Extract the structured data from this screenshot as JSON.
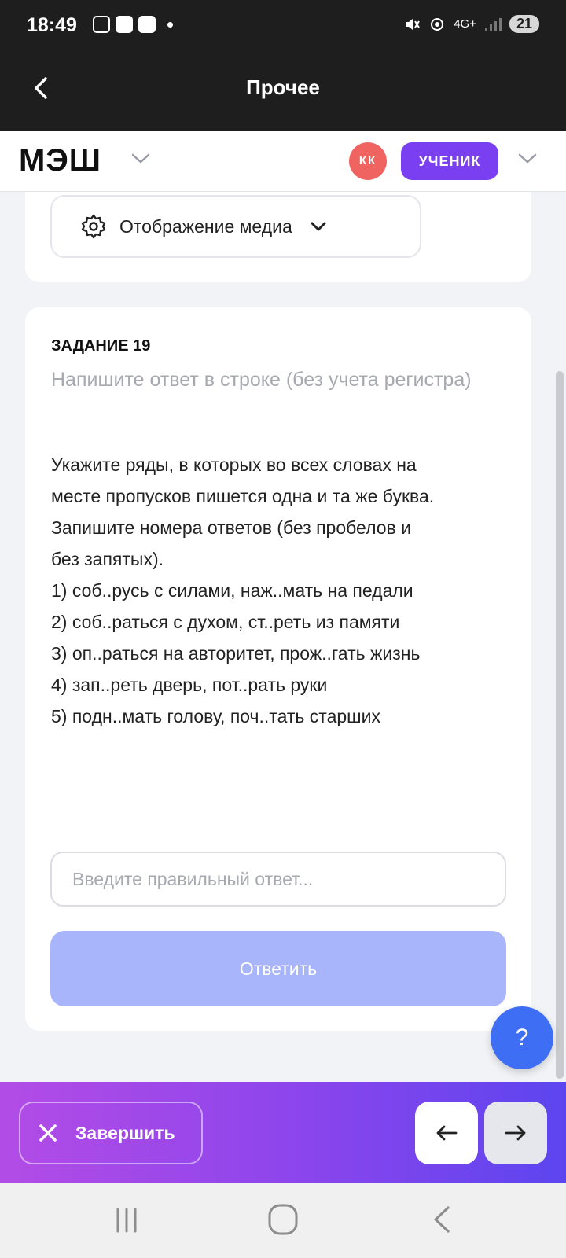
{
  "status_bar": {
    "time": "18:49",
    "network": "4G+",
    "battery": "21"
  },
  "app_bar": {
    "title": "Прочее"
  },
  "header": {
    "logo": "МЭШ",
    "avatar_initials": "КК",
    "role": "УЧЕНИК"
  },
  "media": {
    "label": "Отображение медиа"
  },
  "task": {
    "number": "ЗАДАНИЕ 19",
    "hint": "Напишите ответ в строке (без учета регистра)",
    "lines": [
      "Укажите ряды, в которых во всех словах на",
      "месте пропусков пишется одна и та же буква.",
      "Запишите номера ответов  (без пробелов и",
      "без запятых).",
      "1) соб..русь с силами, наж..мать на педали",
      "2) соб..раться с духом, ст..реть из памяти",
      "3) оп..раться на авторитет, прож..гать жизнь",
      "4) зап..реть дверь, пот..рать руки",
      "5) подн..мать голову, поч..тать старших"
    ],
    "input_placeholder": "Введите правильный ответ...",
    "input_value": "",
    "submit_label": "Ответить"
  },
  "help": {
    "label": "?"
  },
  "bottom_bar": {
    "finish_label": "Завершить",
    "prev_symbol": "←",
    "next_symbol": "→"
  },
  "icons": [
    "chevron-left-icon",
    "chevron-down-icon",
    "gear-icon",
    "close-icon",
    "arrow-left-icon",
    "arrow-right-icon",
    "recents-icon",
    "home-icon",
    "back-icon"
  ],
  "colors": {
    "role_badge": "#7b3ff2",
    "avatar": "#ef6461",
    "submit_disabled": "#a8b5fb",
    "help_fab": "#3d6ef4",
    "bar_gradient_start": "#b34ce6",
    "bar_gradient_end": "#5c45ef"
  }
}
